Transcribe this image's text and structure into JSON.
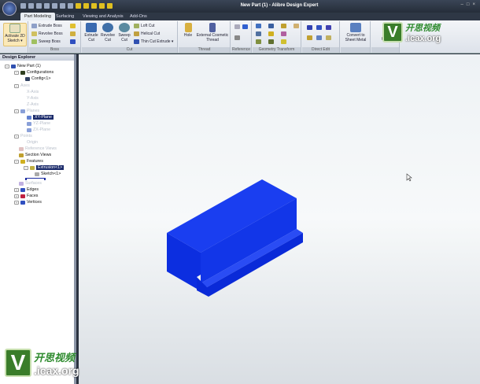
{
  "window": {
    "title": "New Part (1) - Alibre Design Expert",
    "controls": [
      "–",
      "□",
      "×"
    ]
  },
  "tabs": [
    "Part Modeling",
    "Surfacing",
    "Viewing and Analysis",
    "Add-Ons"
  ],
  "ribbon": {
    "activate_sketch": "Activate 2D Sketch ▾",
    "boss": {
      "label": "Boss",
      "items": [
        "Extrude Boss",
        "Revolve Boss",
        "Sweep Boss"
      ]
    },
    "cut": {
      "label": "Cut",
      "big": [
        "Extrude Cut",
        "Revolve Cut",
        "Sweep Cut"
      ],
      "items": [
        "Loft Cut",
        "Helical Cut",
        "Thin Cut Extrude ▾"
      ]
    },
    "thread": {
      "label": "Thread",
      "items": [
        "Hole",
        "External Cosmetic Thread"
      ]
    },
    "reference": {
      "label": "Reference"
    },
    "geometry_transform": {
      "label": "Geometry Transform"
    },
    "direct_edit": {
      "label": "Direct Edit"
    },
    "sheet_metal": {
      "convert": "Convert to Sheet Metal",
      "cont": "Cont"
    }
  },
  "explorer": {
    "title": "Design Explorer",
    "root": "New Part (1)",
    "configurations": "Configurations",
    "config": "Config<1>",
    "axes": "Axes",
    "x_axis": "X-Axis",
    "y_axis": "Y-Axis",
    "z_axis": "Z-Axis",
    "planes": "Planes",
    "xy": "XY-Plane",
    "yz": "YZ-Plane",
    "zx": "ZX-Plane",
    "points": "Points",
    "origin": "Origin",
    "reference_views": "Reference Views",
    "section_views": "Section Views",
    "features": "Features",
    "extrusion": "Extrusion<1>",
    "sketch": "Sketch<1>",
    "surfaces": "Surfaces",
    "edges": "Edges",
    "faces": "Faces",
    "vertices": "Vertices"
  },
  "model": {
    "color": "#1030e8"
  },
  "watermark": {
    "cn": "开思视频",
    "domain": ".icax.org",
    "letter": "V"
  }
}
